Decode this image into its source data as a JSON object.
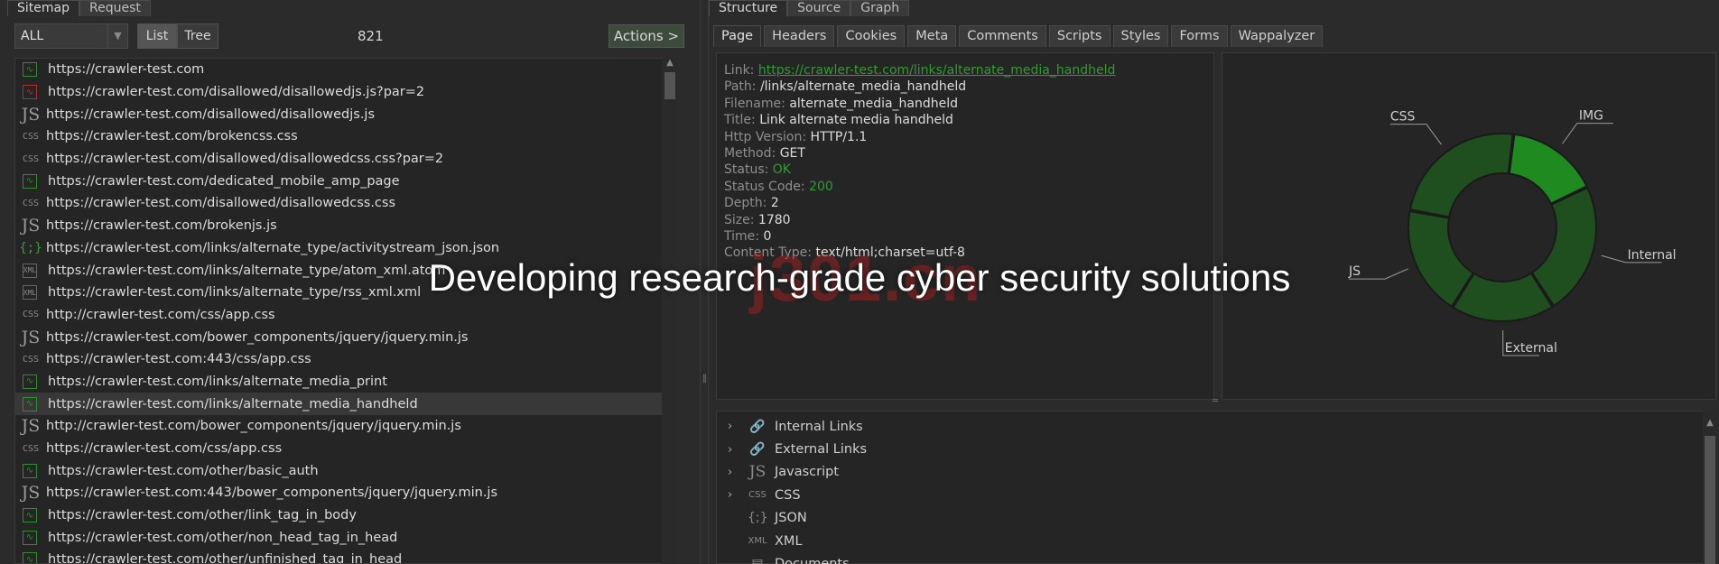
{
  "left": {
    "tabs": [
      "Sitemap",
      "Request"
    ],
    "filter_value": "ALL",
    "view_list": "List",
    "view_tree": "Tree",
    "count": "821",
    "actions_label": "Actions >",
    "urls": [
      {
        "icon": "html",
        "url": "https://crawler-test.com"
      },
      {
        "icon": "html-error",
        "url": "https://crawler-test.com/disallowed/disallowedjs.js?par=2"
      },
      {
        "icon": "js",
        "url": "https://crawler-test.com/disallowed/disallowedjs.js"
      },
      {
        "icon": "css",
        "url": "https://crawler-test.com/brokencss.css"
      },
      {
        "icon": "css",
        "url": "https://crawler-test.com/disallowed/disallowedcss.css?par=2"
      },
      {
        "icon": "html",
        "url": "https://crawler-test.com/dedicated_mobile_amp_page"
      },
      {
        "icon": "css",
        "url": "https://crawler-test.com/disallowed/disallowedcss.css"
      },
      {
        "icon": "js",
        "url": "https://crawler-test.com/brokenjs.js"
      },
      {
        "icon": "json",
        "url": "https://crawler-test.com/links/alternate_type/activitystream_json.json"
      },
      {
        "icon": "xml",
        "url": "https://crawler-test.com/links/alternate_type/atom_xml.atom"
      },
      {
        "icon": "xml",
        "url": "https://crawler-test.com/links/alternate_type/rss_xml.xml"
      },
      {
        "icon": "css",
        "url": "http://crawler-test.com/css/app.css"
      },
      {
        "icon": "js",
        "url": "https://crawler-test.com/bower_components/jquery/jquery.min.js"
      },
      {
        "icon": "css",
        "url": "https://crawler-test.com:443/css/app.css"
      },
      {
        "icon": "html",
        "url": "https://crawler-test.com/links/alternate_media_print"
      },
      {
        "icon": "html",
        "url": "https://crawler-test.com/links/alternate_media_handheld",
        "selected": true
      },
      {
        "icon": "js",
        "url": "http://crawler-test.com/bower_components/jquery/jquery.min.js"
      },
      {
        "icon": "css",
        "url": "https://crawler-test.com/css/app.css"
      },
      {
        "icon": "html",
        "url": "https://crawler-test.com/other/basic_auth"
      },
      {
        "icon": "js",
        "url": "https://crawler-test.com:443/bower_components/jquery/jquery.min.js"
      },
      {
        "icon": "html",
        "url": "https://crawler-test.com/other/link_tag_in_body"
      },
      {
        "icon": "html",
        "url": "https://crawler-test.com/other/non_head_tag_in_head"
      },
      {
        "icon": "html",
        "url": "https://crawler-test.com/other/unfinished_tag_in_head"
      }
    ]
  },
  "right": {
    "tabs": [
      "Structure",
      "Source",
      "Graph"
    ],
    "subtabs": [
      "Page",
      "Headers",
      "Cookies",
      "Meta",
      "Comments",
      "Scripts",
      "Styles",
      "Forms",
      "Wappalyzer"
    ],
    "info": {
      "link_key": "Link:",
      "link_val": "https://crawler-test.com/links/alternate_media_handheld",
      "path_key": "Path:",
      "path_val": "/links/alternate_media_handheld",
      "filename_key": "Filename:",
      "filename_val": "alternate_media_handheld",
      "title_key": "Title:",
      "title_val": "Link alternate media handheld",
      "http_key": "Http Version:",
      "http_val": "HTTP/1.1",
      "method_key": "Method:",
      "method_val": "GET",
      "status_key": "Status:",
      "status_val": "OK",
      "code_key": "Status Code:",
      "code_val": "200",
      "depth_key": "Depth:",
      "depth_val": "2",
      "size_key": "Size:",
      "size_val": "1780",
      "time_key": "Time:",
      "time_val": "0",
      "ctype_key": "Content Type:",
      "ctype_val": "text/html;charset=utf-8"
    },
    "tree_items": [
      {
        "icon": "link",
        "label": "Internal Links"
      },
      {
        "icon": "link",
        "label": "External Links"
      },
      {
        "icon": "js",
        "label": "Javascript"
      },
      {
        "icon": "css",
        "label": "CSS"
      },
      {
        "icon": "json",
        "label": "JSON"
      },
      {
        "icon": "xml",
        "label": "XML"
      },
      {
        "icon": "doc",
        "label": "Documents"
      }
    ]
  },
  "chart_data": {
    "type": "pie",
    "donut": true,
    "categories": [
      "IMG",
      "Internal",
      "External",
      "JS",
      "CSS"
    ],
    "values": [
      16,
      23,
      18,
      19,
      24
    ],
    "colors": [
      "#1f8a1f",
      "#1f4f1f",
      "#1f4f1f",
      "#1f4f1f",
      "#1f4f1f"
    ],
    "start_label": "IMG"
  },
  "overlay": {
    "watermark": "j301.cn",
    "caption": "Developing research-grade cyber security solutions"
  }
}
